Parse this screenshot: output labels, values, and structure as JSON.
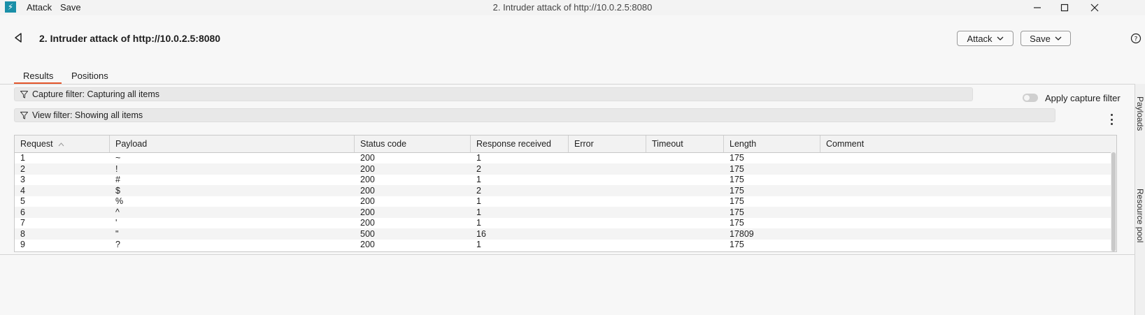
{
  "window": {
    "title": "2. Intruder attack of http://10.0.2.5:8080",
    "menu": [
      "Attack",
      "Save"
    ],
    "logo_color": "#1a8fa8"
  },
  "header": {
    "title": "2. Intruder attack of http://10.0.2.5:8080",
    "attack_button": "Attack",
    "save_button": "Save"
  },
  "tabs": [
    {
      "label": "Results",
      "active": true
    },
    {
      "label": "Positions",
      "active": false
    }
  ],
  "filters": {
    "capture": "Capture filter: Capturing all items",
    "apply_capture": "Apply capture filter",
    "view": "View filter: Showing all items"
  },
  "side_panel": [
    "Payloads",
    "Resource pool"
  ],
  "table": {
    "columns": [
      "Request",
      "Payload",
      "Status code",
      "Response received",
      "Error",
      "Timeout",
      "Length",
      "Comment"
    ],
    "sort_column": "Request",
    "rows": [
      [
        "1",
        "~",
        "200",
        "1",
        "",
        "",
        "175",
        ""
      ],
      [
        "2",
        "!",
        "200",
        "2",
        "",
        "",
        "175",
        ""
      ],
      [
        "3",
        "#",
        "200",
        "1",
        "",
        "",
        "175",
        ""
      ],
      [
        "4",
        "$",
        "200",
        "2",
        "",
        "",
        "175",
        ""
      ],
      [
        "5",
        "%",
        "200",
        "1",
        "",
        "",
        "175",
        ""
      ],
      [
        "6",
        "^",
        "200",
        "1",
        "",
        "",
        "175",
        ""
      ],
      [
        "7",
        "'",
        "200",
        "1",
        "",
        "",
        "175",
        ""
      ],
      [
        "8",
        "\"",
        "500",
        "16",
        "",
        "",
        "17809",
        ""
      ],
      [
        "9",
        "?",
        "200",
        "1",
        "",
        "",
        "175",
        ""
      ]
    ]
  },
  "accent_color": "#e5562c"
}
